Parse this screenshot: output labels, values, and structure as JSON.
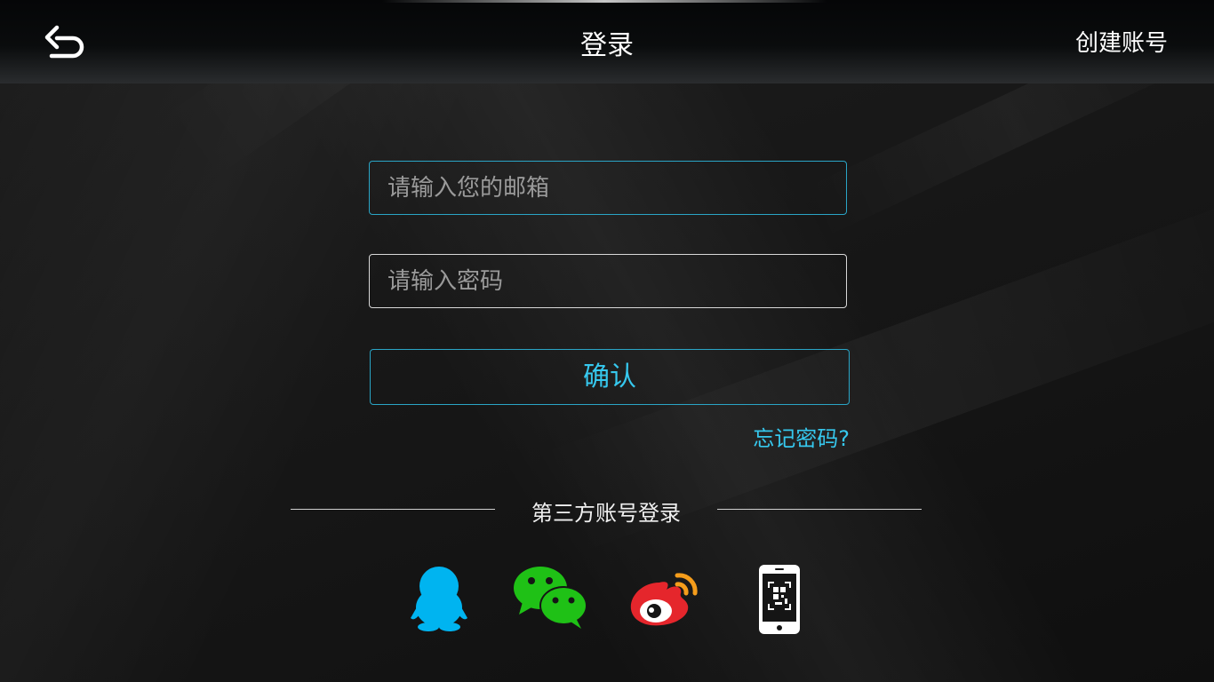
{
  "header": {
    "back_icon": "back-arrow-icon",
    "title": "登录",
    "create_account": "创建账号"
  },
  "form": {
    "email_placeholder": "请输入您的邮箱",
    "password_placeholder": "请输入密码",
    "confirm_label": "确认",
    "forgot_password": "忘记密码?"
  },
  "third_party": {
    "label": "第三方账号登录",
    "providers": [
      {
        "icon": "qq-icon",
        "color": "#00b4f0"
      },
      {
        "icon": "wechat-icon",
        "color": "#1fc116"
      },
      {
        "icon": "weibo-icon",
        "color": "#e5262c"
      },
      {
        "icon": "phone-qr-icon",
        "color": "#ffffff"
      }
    ]
  },
  "colors": {
    "accent": "#36c8ee",
    "border_accent": "#2aa5c6",
    "background": "#151515"
  }
}
